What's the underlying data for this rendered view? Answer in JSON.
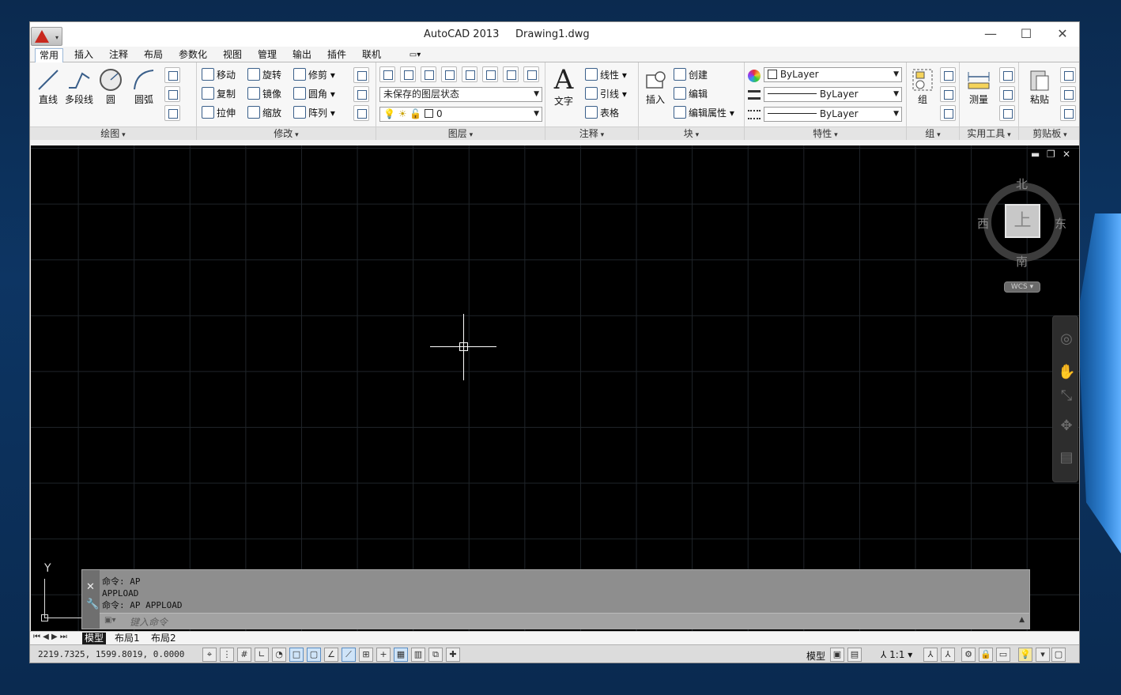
{
  "window": {
    "title": "AutoCAD 2013     Drawing1.dwg"
  },
  "window_controls": {
    "minimize": "—",
    "maximize": "☐",
    "close": "✕"
  },
  "tabs": [
    "常用",
    "插入",
    "注释",
    "布局",
    "参数化",
    "视图",
    "管理",
    "输出",
    "插件",
    "联机"
  ],
  "ribbon": {
    "draw": {
      "label": "绘图",
      "line": "直线",
      "polyline": "多段线",
      "circle": "圆",
      "arc": "圆弧"
    },
    "modify": {
      "label": "修改",
      "move": "移动",
      "rotate": "旋转",
      "trim": "修剪",
      "copy": "复制",
      "mirror": "镜像",
      "fillet": "圆角",
      "stretch": "拉伸",
      "scale": "缩放",
      "array": "阵列"
    },
    "layers": {
      "label": "图层",
      "layer_state": "未保存的图层状态",
      "current_layer": "0"
    },
    "annotation": {
      "label": "注释",
      "text": "文字",
      "dimension": "线性",
      "leader": "引线",
      "table": "表格"
    },
    "block": {
      "label": "块",
      "insert": "插入",
      "create": "创建",
      "edit": "编辑",
      "edit_attributes": "编辑属性"
    },
    "properties": {
      "label": "特性",
      "color": "ByLayer",
      "lineweight": "ByLayer",
      "linetype": "ByLayer"
    },
    "groups": {
      "label": "组",
      "group": "组"
    },
    "utilities": {
      "label": "实用工具",
      "measure": "测量"
    },
    "clipboard": {
      "label": "剪贴板",
      "paste": "粘贴"
    }
  },
  "viewcube": {
    "north": "北",
    "south": "南",
    "east": "东",
    "west": "西",
    "face": "上",
    "wcs": "WCS ▾"
  },
  "ucs": {
    "y": "Y"
  },
  "command": {
    "lines": [
      "命令: AP",
      "APPLOAD",
      "命令: AP APPLOAD"
    ],
    "placeholder": "键入命令"
  },
  "layout_tabs": [
    "模型",
    "布局1",
    "布局2"
  ],
  "status": {
    "coords": "2219.7325, 1599.8019, 0.0000",
    "model": "模型",
    "scale": "1:1 ▾"
  },
  "colors": {
    "canvas": "#000000",
    "accent": "#c8281e",
    "command_bg": "#8e8e8e"
  }
}
